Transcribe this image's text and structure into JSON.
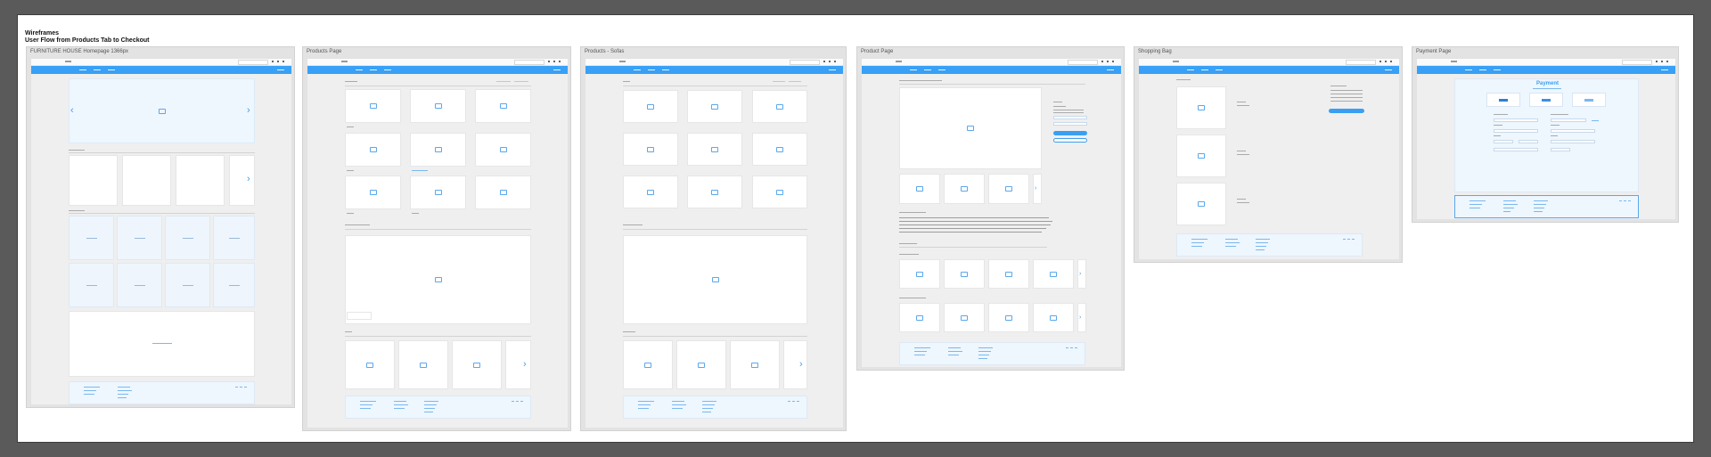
{
  "document": {
    "title": "Wireframes",
    "subtitle": "User Flow from Products Tab to Checkout"
  },
  "artboards": [
    {
      "id": "home",
      "label": "FURNITURE HOUSE Homepage 1366px"
    },
    {
      "id": "products",
      "label": "Products Page"
    },
    {
      "id": "sofas",
      "label": "Products - Sofas"
    },
    {
      "id": "product",
      "label": "Product Page"
    },
    {
      "id": "bag",
      "label": "Shopping Bag"
    },
    {
      "id": "payment",
      "label": "Payment Page"
    }
  ],
  "payment": {
    "heading": "Payment"
  },
  "colors": {
    "nav_bar": "#38a0f6",
    "accent_blue": "#3b9ff1",
    "artboard_bg": "#e3e3e3",
    "canvas_bg": "#ffffff",
    "workspace_bg": "#5a5a5a",
    "footer_bg": "#eef6fe"
  },
  "icons": {
    "image_placeholder": "image-placeholder-icon",
    "carousel_prev": "chevron-left-icon",
    "carousel_next": "chevron-right-icon"
  }
}
